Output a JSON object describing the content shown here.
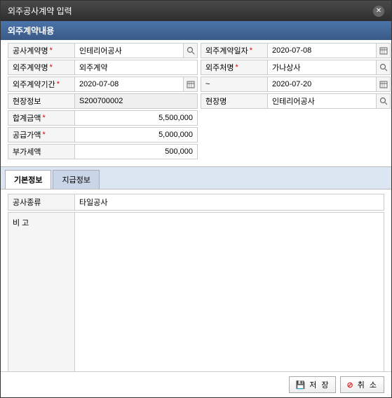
{
  "title": "외주공사계약 입력",
  "section_title": "외주계약내용",
  "labels": {
    "construction_contract": "공사계약명",
    "subcontract_date": "외주계약일자",
    "subcontract_name": "외주계약명",
    "subcontractor": "외주처명",
    "subcontract_period": "외주계약기간",
    "period_tilde": "~",
    "site_info": "현장정보",
    "site_name": "현장명",
    "total_amount": "합계금액",
    "supply_amount": "공급가액",
    "vat_amount": "부가세액",
    "work_type": "공사종류",
    "memo": "비   고"
  },
  "values": {
    "construction_contract": "인테리어공사",
    "subcontract_date": "2020-07-08",
    "subcontract_name": "외주계약",
    "subcontractor": "가나상사",
    "period_from": "2020-07-08",
    "period_to": "2020-07-20",
    "site_info": "S200700002",
    "site_name": "인테리어공사",
    "total_amount": "5,500,000",
    "supply_amount": "5,000,000",
    "vat_amount": "500,000",
    "work_type": "타일공사",
    "memo": ""
  },
  "tabs": {
    "basic": "기본정보",
    "payment": "지급정보"
  },
  "buttons": {
    "save": "저 장",
    "cancel": "취 소"
  }
}
